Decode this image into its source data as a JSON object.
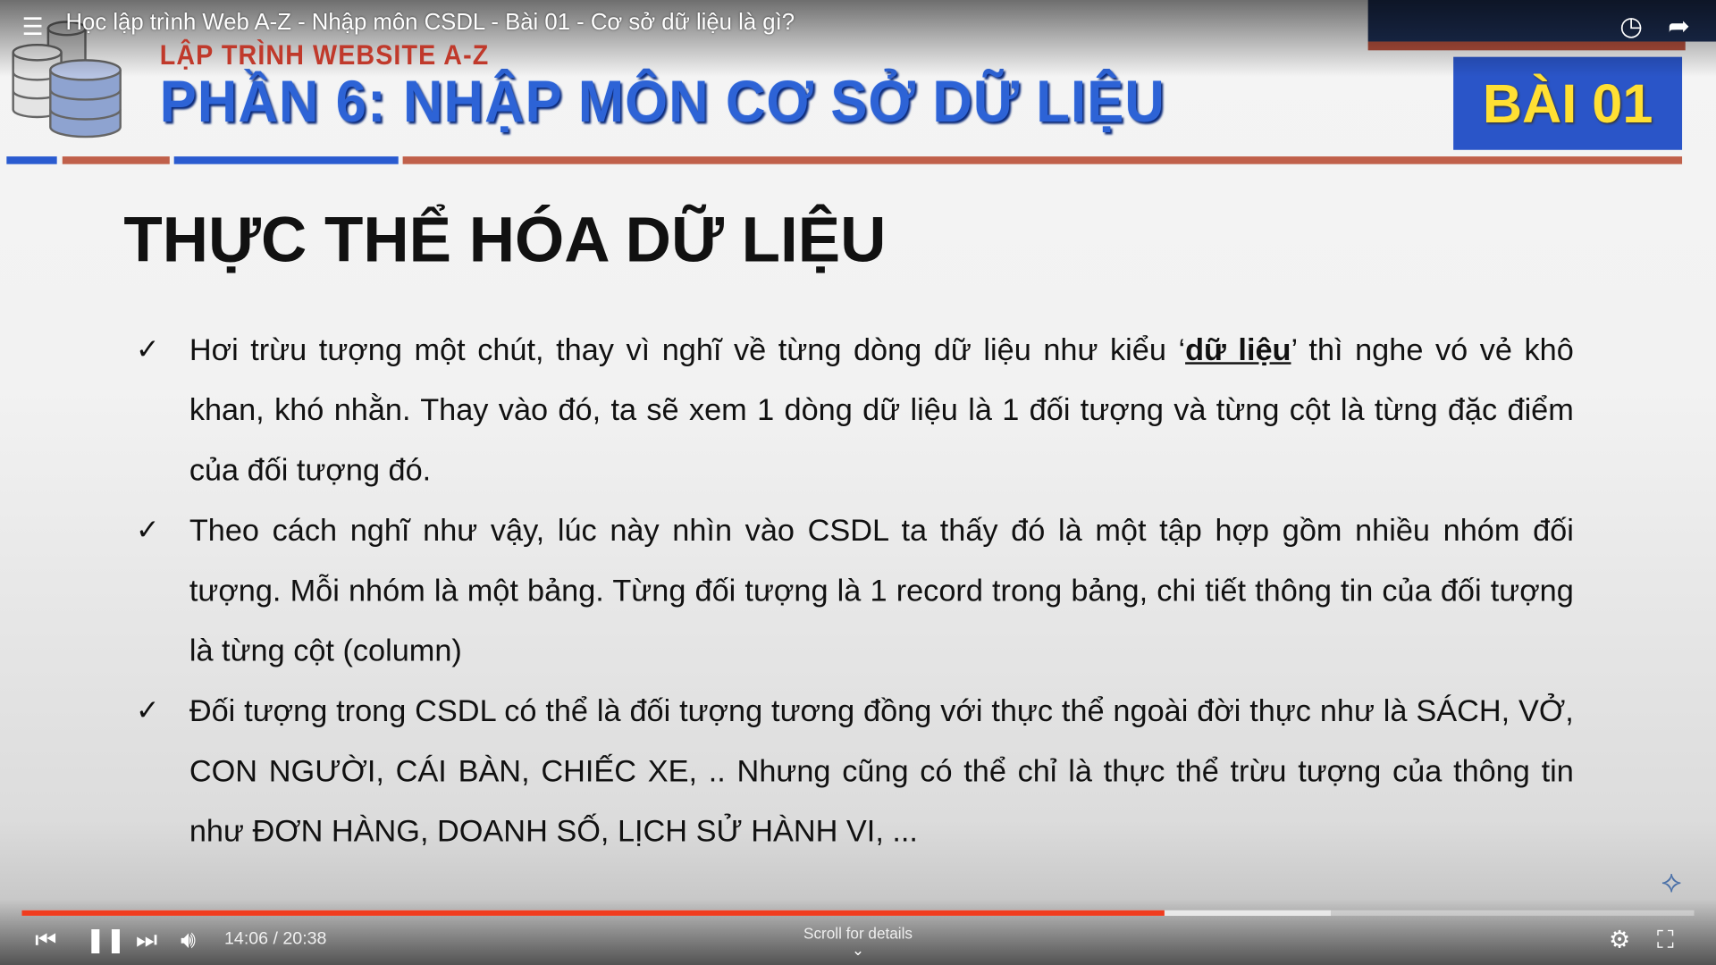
{
  "player": {
    "video_title": "Học lập trình Web A-Z - Nhập môn CSDL - Bài 01 - Cơ sở dữ liệu là gì?",
    "current_time": "14:06",
    "duration": "20:38",
    "time_separator": " / ",
    "progress_fraction": 0.683,
    "buffered_fraction": 0.783,
    "scroll_hint": "Scroll for details",
    "icons": {
      "playlist": "playlist-icon",
      "watch_later": "clock-icon",
      "share": "share-icon",
      "prev": "previous-icon",
      "pause": "pause-icon",
      "next": "next-icon",
      "volume": "volume-icon",
      "settings": "gear-icon",
      "exit_fullscreen": "exit-fullscreen-icon"
    },
    "colors": {
      "progress": "#f03c1e"
    }
  },
  "slide": {
    "series": "LẬP TRÌNH WEBSITE A-Z",
    "part_title": "PHẦN 6: NHẬP MÔN CƠ SỞ DỮ LIỆU",
    "lesson_badge": "BÀI 01",
    "heading": "THỰC THỂ HÓA DỮ LIỆU",
    "check": "✓",
    "bullets": [
      {
        "before": "Hơi trừu tượng một chút, thay vì nghĩ về từng dòng dữ liệu như kiểu ‘",
        "emph": "dữ liệu",
        "after": "’ thì nghe vó vẻ khô khan, khó nhằn. Thay vào đó, ta sẽ xem 1 dòng dữ liệu là 1 đối tượng và từng cột là từng đặc điểm của đối tượng đó."
      },
      {
        "text": "Theo cách nghĩ như vậy, lúc này nhìn vào CSDL ta thấy đó là một tập hợp gồm nhiều nhóm đối tượng. Mỗi nhóm là một bảng. Từng đối tượng là 1 record trong bảng, chi tiết thông tin của đối tượng là từng cột (column)"
      },
      {
        "text": "Đối tượng trong CSDL có thể là đối tượng tương đồng với thực thể ngoài đời thực như là SÁCH, VỞ, CON NGƯỜI, CÁI BÀN, CHIẾC XE, .. Nhưng cũng có thể chỉ là thực thể trừu tượng của thông tin như ĐƠN HÀNG, DOANH SỐ, LỊCH SỬ HÀNH VI, ..."
      }
    ],
    "colors": {
      "part_title": "#2d63d6",
      "badge_bg": "#2a55c8",
      "badge_text": "#ffe033",
      "accent_line": "#b5503d"
    }
  }
}
